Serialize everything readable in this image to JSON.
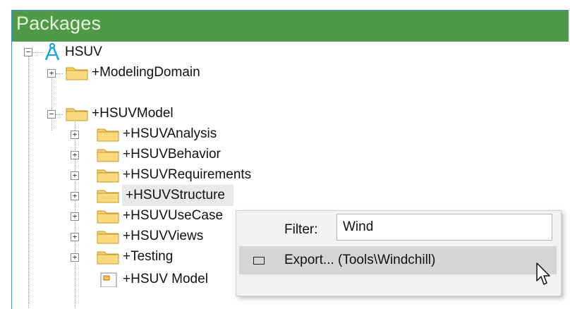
{
  "panel": {
    "title": "Packages"
  },
  "tree": {
    "root": {
      "label": "HSUV"
    },
    "items": [
      {
        "label": "+ModelingDomain"
      },
      {
        "label": "+HSUVModel"
      },
      {
        "label": "+HSUVAnalysis"
      },
      {
        "label": "+HSUVBehavior"
      },
      {
        "label": "+HSUVRequirements"
      },
      {
        "label": "+HSUVStructure"
      },
      {
        "label": "+HSUVUseCase"
      },
      {
        "label": "+HSUVViews"
      },
      {
        "label": "+Testing"
      },
      {
        "label": "+HSUV Model"
      }
    ]
  },
  "context_menu": {
    "filter_label": "Filter:",
    "filter_value": "Wind",
    "export_label": "Export... (Tools\\Windchill)"
  },
  "colors": {
    "titlebar": "#4f9a46",
    "folder": "#f2c14e",
    "root_icon": "#1aa3d8"
  }
}
